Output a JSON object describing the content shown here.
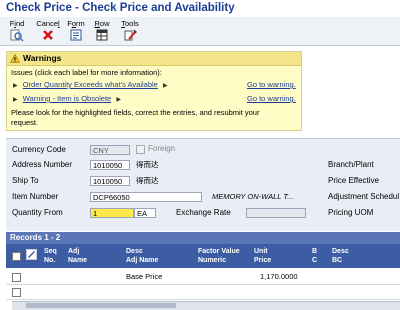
{
  "title": "Check Price - Check Price and Availability",
  "toolbar": [
    {
      "pre": "F",
      "key": "i",
      "post": "nd",
      "icon": "find-icon"
    },
    {
      "pre": "Cance",
      "key": "l",
      "post": "",
      "icon": "cancel-icon"
    },
    {
      "pre": "F",
      "key": "o",
      "post": "rm",
      "icon": "form-icon"
    },
    {
      "pre": "",
      "key": "R",
      "post": "ow",
      "icon": "row-icon"
    },
    {
      "pre": "",
      "key": "T",
      "post": "ools",
      "icon": "tools-icon"
    }
  ],
  "warnings": {
    "header": "Warnings",
    "intro": "Issues (click each label for more information):",
    "items": [
      {
        "label": "Order Quantity Exceeds what's Available",
        "link": "Go to warning."
      },
      {
        "label": "Warning - Item is Obsolete",
        "link": "Go to warning."
      }
    ],
    "footer_line1": "Please look for the highlighted fields, correct the entries, and resubmit your",
    "footer_line2": "request."
  },
  "form": {
    "currency_code_label": "Currency Code",
    "currency_code_value": "CNY",
    "foreign_label": "Foreign",
    "address_number_label": "Address Number",
    "address_number_value": "1010050",
    "address_number_desc": "得而达",
    "ship_to_label": "Ship To",
    "ship_to_value": "1010050",
    "ship_to_desc": "得而达",
    "item_number_label": "Item Number",
    "item_number_value": "DCP66050",
    "item_number_desc": "MEMORY ON-WALL T...",
    "quantity_from_label": "Quantity From",
    "quantity_from_value": "1",
    "quantity_uom_value": "EA",
    "exchange_rate_label": "Exchange Rate",
    "exchange_rate_value": "",
    "branch_plant_label": "Branch/Plant",
    "price_effective_label": "Price Effective",
    "adjustment_schedule_label": "Adjustment Schedul",
    "pricing_uom_label": "Pricing UOM"
  },
  "grid": {
    "records_label": "Records 1 - 2",
    "columns": [
      {
        "l1": "Seq",
        "l2": "No."
      },
      {
        "l1": "Adj",
        "l2": "Name"
      },
      {
        "l1": "Desc",
        "l2": "Adj Name"
      },
      {
        "l1": "Factor Value",
        "l2": "Numeric"
      },
      {
        "l1": "Unit",
        "l2": "Price"
      },
      {
        "l1": "B",
        "l2": "C"
      },
      {
        "l1": "Desc",
        "l2": "BC"
      }
    ],
    "rows": [
      {
        "desc_adj_name": "Base Price",
        "unit_price": "1,170.0000"
      },
      {
        "desc_adj_name": "",
        "unit_price": ""
      }
    ]
  },
  "colors": {
    "title": "#1c3d96",
    "warning_bg": "#fffcc6",
    "grid_header": "#3c5da3",
    "highlight": "#ffe84a"
  }
}
